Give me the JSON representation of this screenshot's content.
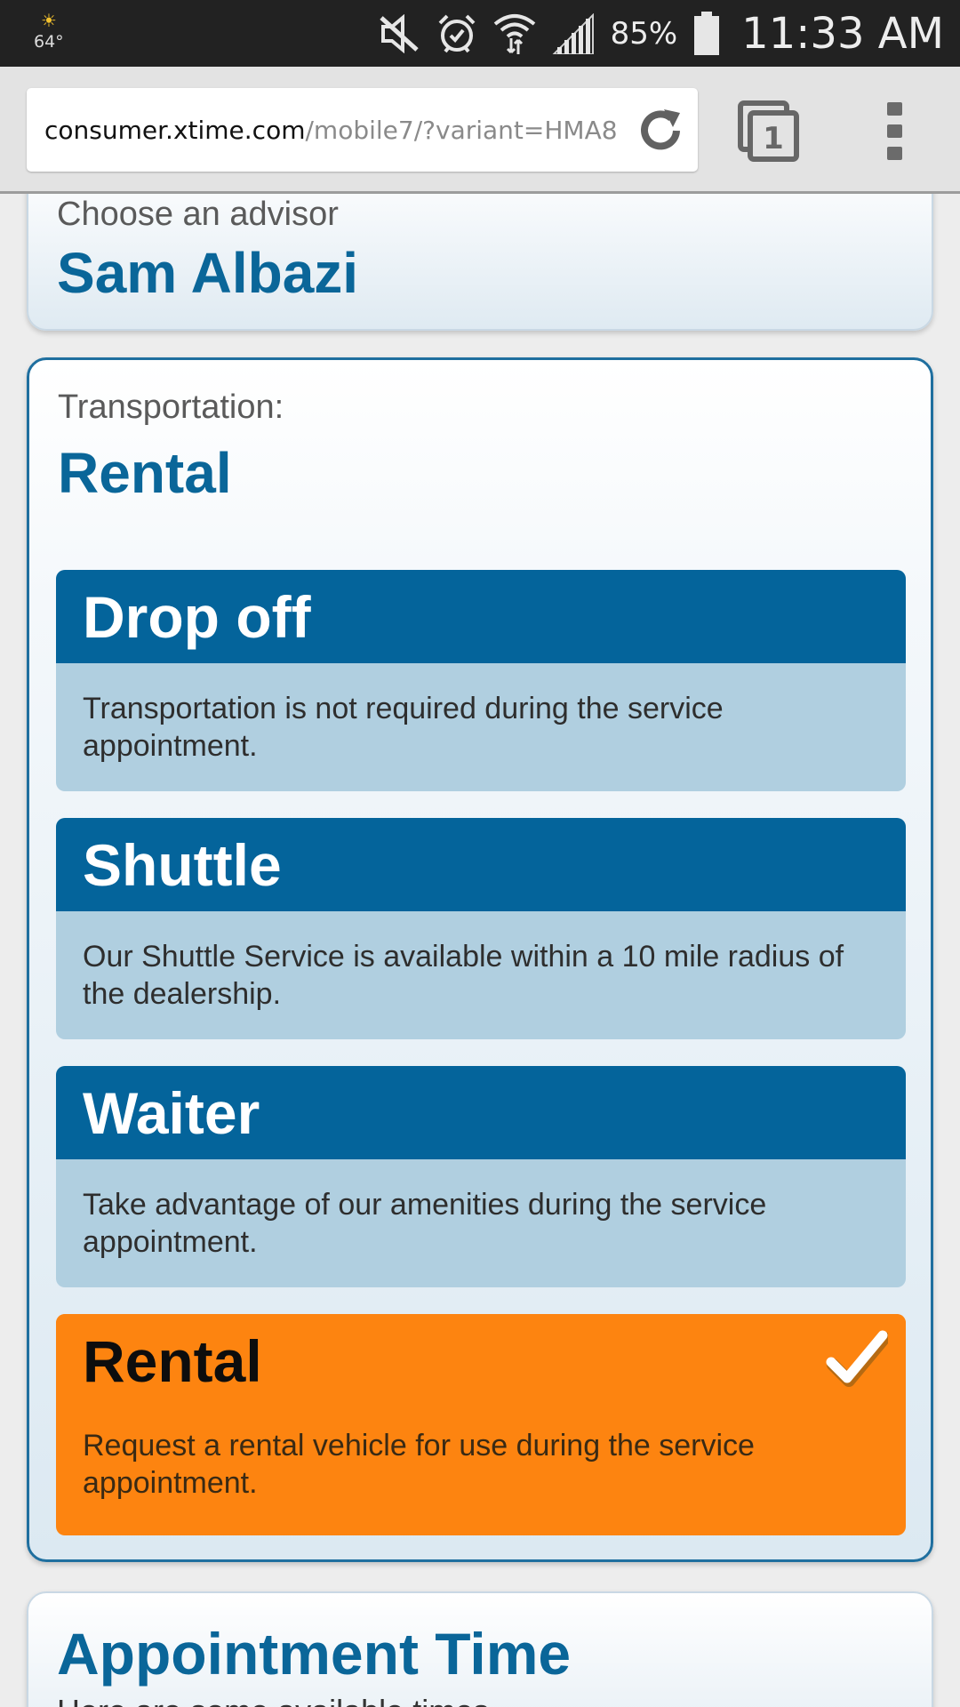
{
  "status_bar": {
    "temperature": "64°",
    "battery_percent": "85%",
    "time": "11:33 AM"
  },
  "browser": {
    "url_host": "consumer.xtime.com",
    "url_path": "/mobile7/?variant=HMA8",
    "tab_count": "1"
  },
  "advisor": {
    "label": "Choose an advisor",
    "value": "Sam Albazi"
  },
  "transportation": {
    "label": "Transportation:",
    "value": "Rental",
    "options": [
      {
        "title": "Drop off",
        "description": "Transportation is not required during the service appointment.",
        "selected": false
      },
      {
        "title": "Shuttle",
        "description": "Our Shuttle Service is available within a 10 mile radius of the dealership.",
        "selected": false
      },
      {
        "title": "Waiter",
        "description": "Take advantage of our amenities during the service appointment.",
        "selected": false
      },
      {
        "title": "Rental",
        "description": "Request a rental vehicle for use during the service appointment.",
        "selected": true
      }
    ]
  },
  "appointment_time": {
    "heading": "Appointment Time",
    "subtext": "Here are some available times"
  },
  "colors": {
    "brand_blue": "#04649b",
    "option_body": "#b0cfe0",
    "selected_orange": "#fd8410",
    "status_bar": "#222222"
  },
  "icons": [
    "weather-icon",
    "mute-icon",
    "alarm-icon",
    "wifi-icon",
    "signal-icon",
    "battery-icon",
    "reload-icon",
    "tabs-icon",
    "overflow-menu-icon",
    "checkmark-icon"
  ]
}
